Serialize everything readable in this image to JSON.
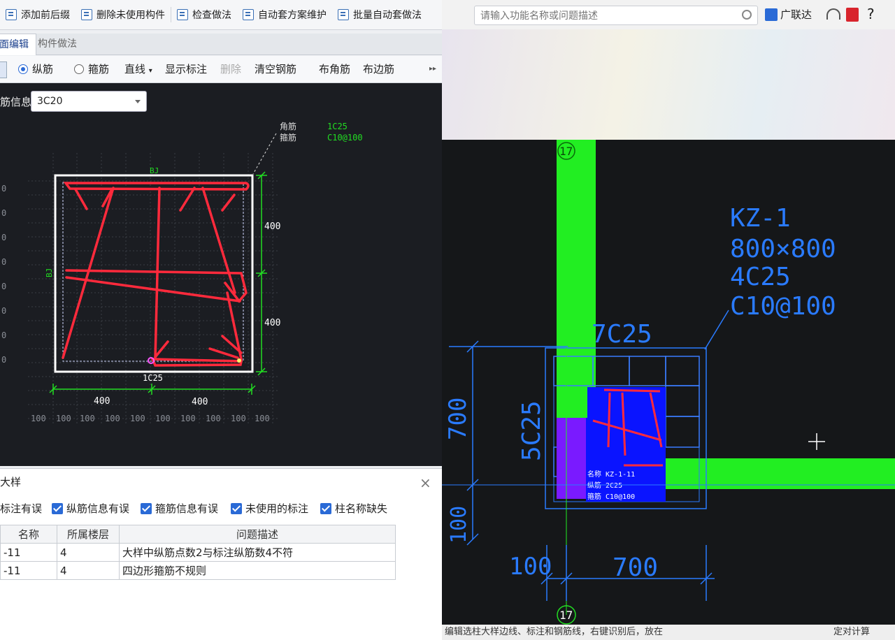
{
  "toolbar": {
    "add_prefix": "添加前后缀",
    "delete_unused": "删除未使用构件",
    "check_method": "检查做法",
    "auto_scheme": "自动套方案维护",
    "batch_auto": "批量自动套做法"
  },
  "tabs": {
    "edit": "面编辑",
    "method": "构件做法"
  },
  "rebar_toolbar": {
    "longitudinal": "纵筋",
    "stirrup": "箍筋",
    "line_mode": "直线",
    "show_label": "显示标注",
    "delete": "删除",
    "clear_rebar": "清空钢筋",
    "corner_rebar": "布角筋",
    "edge_rebar": "布边筋",
    "more": "▸▸"
  },
  "rebar_info": {
    "label": "筋信息:",
    "value": "3C20"
  },
  "section": {
    "corner_label": "角筋",
    "stirrup_label": "箍筋",
    "corner_value": "1C25",
    "stirrup_value": "C10@100",
    "bj": "BJ",
    "dim_400": "400",
    "bottom_label": "1C25",
    "grid_100": "100",
    "side_nums": [
      "0",
      "0",
      "0",
      "0",
      "0",
      "0",
      "0",
      "0"
    ]
  },
  "dialog": {
    "title": "大样",
    "close": "×",
    "filters": [
      {
        "label": "标注有误",
        "checked": false
      },
      {
        "label": "纵筋信息有误",
        "checked": true
      },
      {
        "label": "箍筋信息有误",
        "checked": true
      },
      {
        "label": "未使用的标注",
        "checked": true
      },
      {
        "label": "柱名称缺失",
        "checked": true
      }
    ],
    "columns": [
      "名称",
      "所属楼层",
      "问题描述"
    ],
    "rows": [
      {
        "name": "-11",
        "floor": "4",
        "desc": "大样中纵筋点数2与标注纵筋数4不符"
      },
      {
        "name": "-11",
        "floor": "4",
        "desc": "四边形箍筋不规则"
      }
    ]
  },
  "right": {
    "search_placeholder": "请输入功能名称或问题描述",
    "user": "广联达",
    "help": "?",
    "column_name": "KZ-1",
    "column_size": "800×800",
    "column_corner": "4C25",
    "column_stirrup": "C10@100",
    "top_rebar": "7C25",
    "side_rebar": "5C25",
    "dim_700": "700",
    "dim_100": "100",
    "axis": "17",
    "mini_name": "名称 KZ-1-11",
    "mini_long": "纵筋 2C25",
    "mini_stir": "箍筋 C10@100",
    "status": "编辑选柱大样边线、标注和钢筋线，右键识别后，放在",
    "status_right": "定对计算"
  },
  "colors": {
    "rebar_red": "#ff2a3c",
    "dim_green": "#22dd22",
    "cad_blue": "#2a7bff",
    "green_fill": "#22ee22",
    "column_fill": "#0a14ff",
    "purple_fill": "#7a1aff"
  }
}
